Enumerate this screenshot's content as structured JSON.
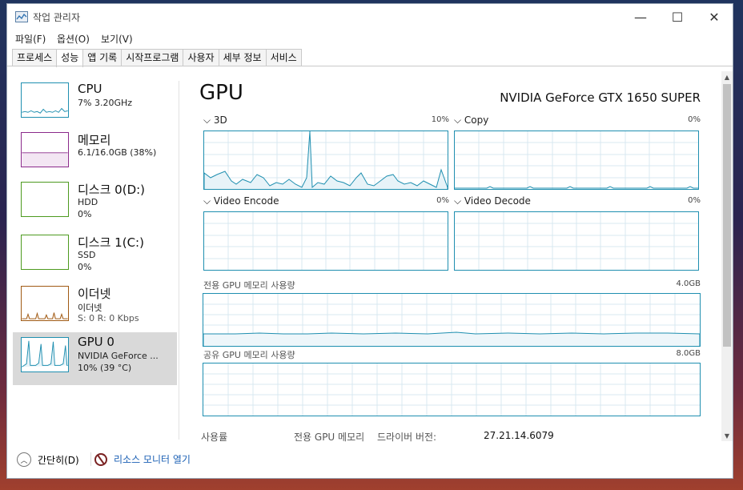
{
  "window": {
    "title": "작업 관리자"
  },
  "controls": {
    "minimize": "—",
    "maximize": "☐",
    "close": "✕"
  },
  "menu": [
    "파일(F)",
    "옵션(O)",
    "보기(V)"
  ],
  "tabs": [
    "프로세스",
    "성능",
    "앱 기록",
    "시작프로그램",
    "사용자",
    "세부 정보",
    "서비스"
  ],
  "active_tab": "성능",
  "sidebar": [
    {
      "title": "CPU",
      "line1": "7% 3.20GHz",
      "line2": ""
    },
    {
      "title": "메모리",
      "line1": "6.1/16.0GB (38%)",
      "line2": ""
    },
    {
      "title": "디스크 0(D:)",
      "line1": "HDD",
      "line2": "0%"
    },
    {
      "title": "디스크 1(C:)",
      "line1": "SSD",
      "line2": "0%"
    },
    {
      "title": "이더넷",
      "line1": "이더넷",
      "line2": "S: 0 R: 0 Kbps"
    },
    {
      "title": "GPU 0",
      "line1": "NVIDIA GeForce ...",
      "line2": "10% (39 °C)"
    }
  ],
  "main": {
    "title": "GPU",
    "device": "NVIDIA GeForce GTX 1650 SUPER",
    "graphs": [
      {
        "label": "3D",
        "pct": "10%"
      },
      {
        "label": "Copy",
        "pct": "0%"
      },
      {
        "label": "Video Encode",
        "pct": "0%"
      },
      {
        "label": "Video Decode",
        "pct": "0%"
      }
    ],
    "dedicated": {
      "label": "전용 GPU 메모리 사용량",
      "max": "4.0GB"
    },
    "shared": {
      "label": "공유 GPU 메모리 사용량",
      "max": "8.0GB"
    },
    "bottom": {
      "usage_label": "사용률",
      "dedicated_label": "전용 GPU 메모리",
      "driver_label": "드라이버 버전:",
      "driver_value": "27.21.14.6079"
    }
  },
  "footer": {
    "less": "간단히(D)",
    "monitor": "리소스 모니터 열기"
  },
  "colors": {
    "cpu": "#1f8fb0",
    "memory": "#8b2a8b",
    "disk": "#4d9a1f",
    "ethernet": "#a05a14",
    "gpu": "#1f8fb0"
  }
}
